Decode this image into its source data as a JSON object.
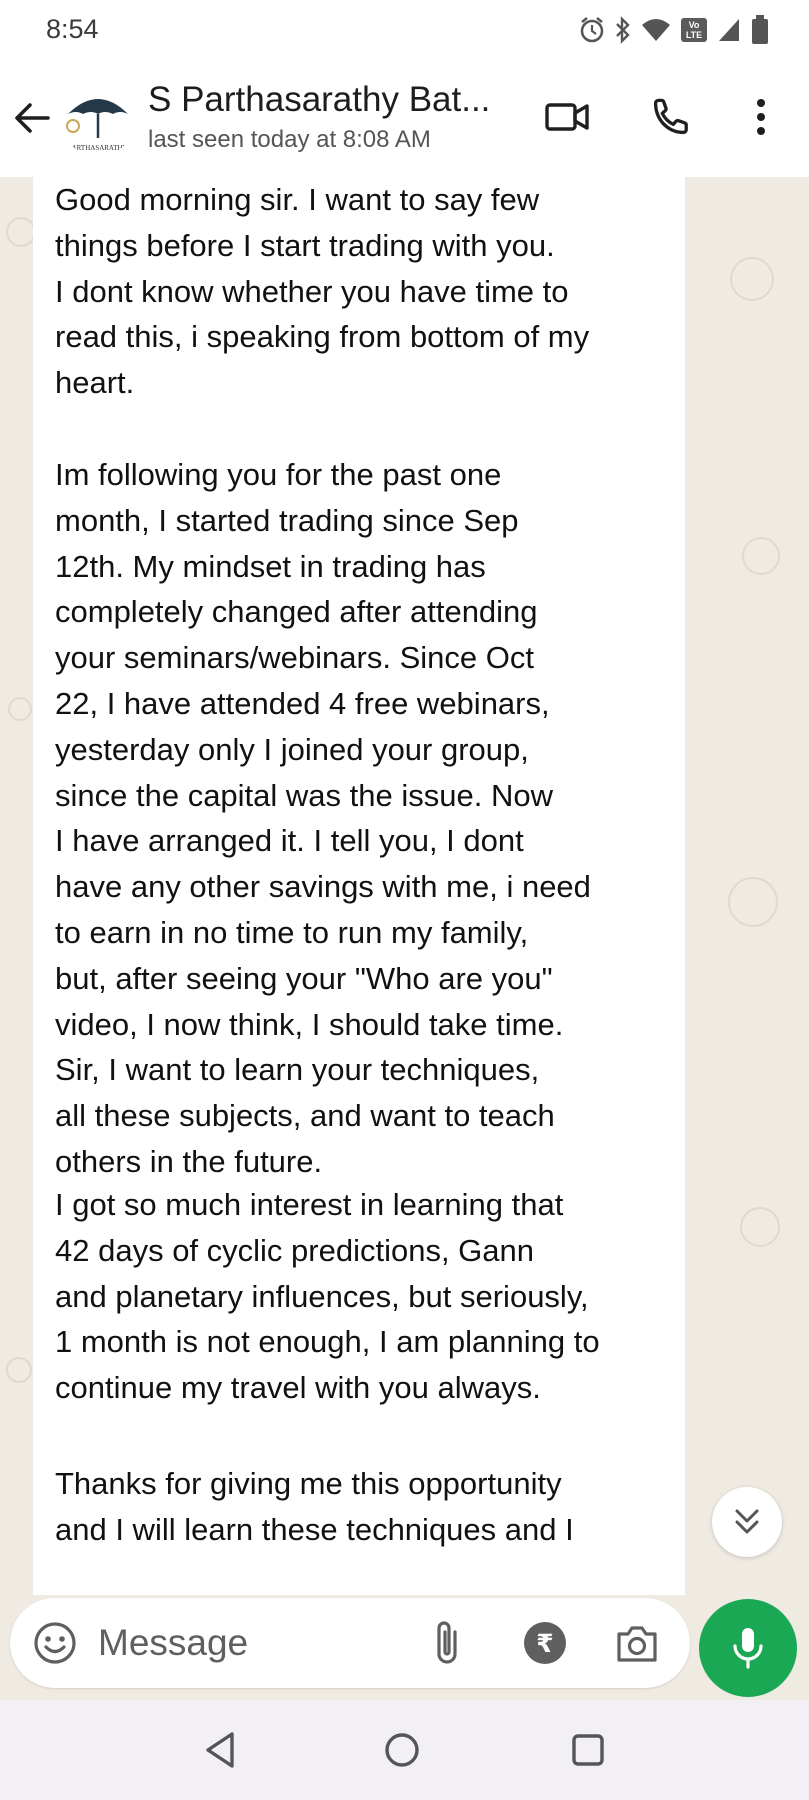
{
  "status_bar": {
    "time": "8:54",
    "volte_label": "Vo LTE",
    "icons": [
      "alarm-icon",
      "bluetooth-icon",
      "wifi-icon",
      "volte-icon",
      "signal-icon",
      "battery-icon"
    ]
  },
  "header": {
    "contact_name": "S Parthasarathy Bat...",
    "last_seen": "last seen today at 8:08 AM",
    "avatar_caption": "PARTHASARATHY",
    "icons": [
      "back-arrow-icon",
      "video-call-icon",
      "phone-call-icon",
      "more-vert-icon"
    ]
  },
  "message": {
    "paragraphs": [
      "Good morning sir. I want to say few\nthings before I start trading with you.\nI dont know whether you have time to\nread this, i speaking from bottom of my\nheart.",
      "Im following you for the past one\nmonth, I started trading since Sep\n12th. My mindset in trading has\ncompletely changed after attending\nyour seminars/webinars. Since Oct\n22, I have attended 4 free webinars,\nyesterday only I joined your group,\nsince the capital was the issue. Now\nI have arranged it. I tell you, I dont\nhave any other savings with me, i need\nto earn in no time to run my family,\nbut, after seeing your \"Who are you\"\nvideo, I now think, I should take time.\nSir, I want to learn your techniques,\nall these subjects, and want to teach\nothers in the future.",
      "I got so much interest in learning that\n42 days of cyclic predictions, Gann\nand planetary influences, but seriously,\n1 month is not enough, I am planning to\ncontinue my travel with you always.",
      "Thanks for giving me this opportunity\nand I will learn these techniques and I"
    ]
  },
  "input": {
    "placeholder": "Message",
    "rupee_symbol": "₹",
    "icons": [
      "emoji-icon",
      "paperclip-icon",
      "rupee-icon",
      "camera-icon",
      "mic-icon"
    ]
  },
  "nav": {
    "icons": [
      "nav-back-icon",
      "nav-home-icon",
      "nav-recents-icon"
    ]
  },
  "colors": {
    "chat_background": "#efeae2",
    "bubble": "#ffffff",
    "mic_button": "#1aa855",
    "nav_bar": "#f2f0f5"
  }
}
